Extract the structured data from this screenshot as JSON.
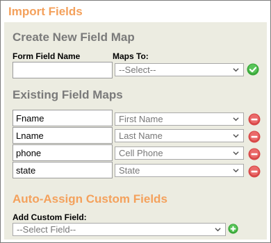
{
  "title": "Import Fields",
  "create": {
    "heading": "Create New Field Map",
    "form_field_label": "Form Field Name",
    "maps_to_label": "Maps To:",
    "form_field_value": "",
    "select_value": "--Select--"
  },
  "existing": {
    "heading": "Existing Field Maps",
    "rows": [
      {
        "field": "Fname",
        "mapped": "First Name"
      },
      {
        "field": "Lname",
        "mapped": "Last Name"
      },
      {
        "field": "phone",
        "mapped": "Cell Phone"
      },
      {
        "field": "state",
        "mapped": "State"
      }
    ]
  },
  "auto": {
    "heading": "Auto-Assign Custom Fields",
    "add_label": "Add Custom Field:",
    "select_value": "--Select Field--"
  },
  "colors": {
    "accent": "#f4a15c",
    "panel_bg": "#ecece1",
    "confirm": "#3aa83a",
    "remove": "#e05a5a"
  }
}
